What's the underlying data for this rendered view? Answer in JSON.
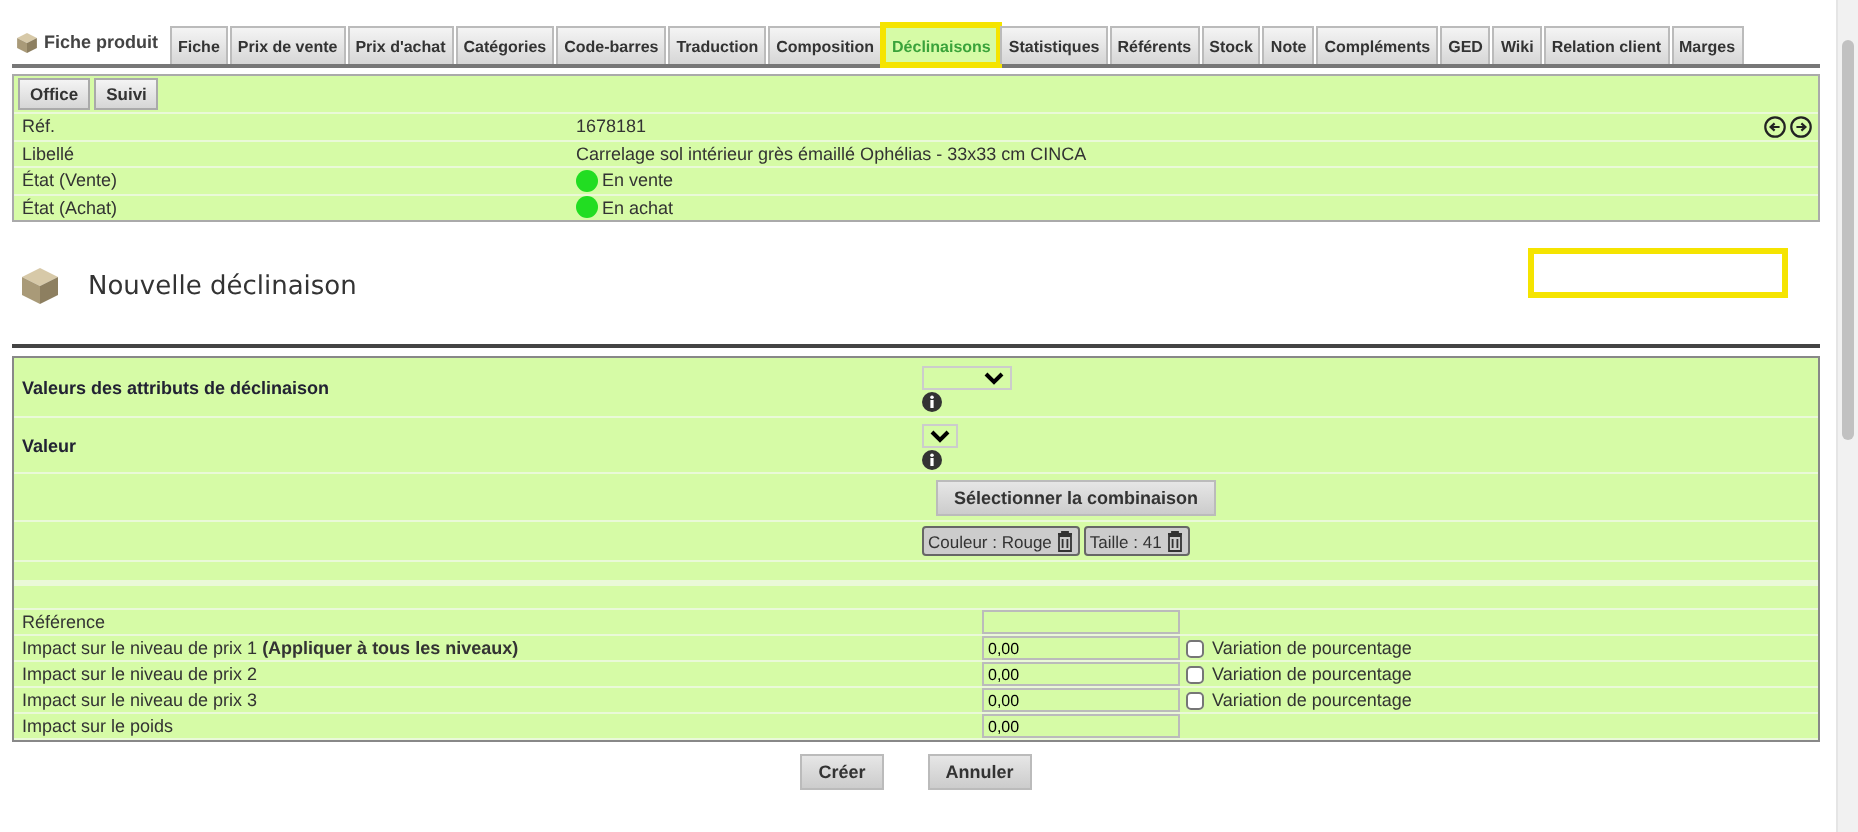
{
  "header": {
    "title": "Fiche produit"
  },
  "tabs": [
    {
      "label": "Fiche",
      "selected": false
    },
    {
      "label": "Prix de vente",
      "selected": false
    },
    {
      "label": "Prix d'achat",
      "selected": false
    },
    {
      "label": "Catégories",
      "selected": false
    },
    {
      "label": "Code-barres",
      "selected": false
    },
    {
      "label": "Traduction",
      "selected": false
    },
    {
      "label": "Composition",
      "selected": false
    },
    {
      "label": "Déclinaisons",
      "selected": true
    },
    {
      "label": "Statistiques",
      "selected": false
    },
    {
      "label": "Référents",
      "selected": false
    },
    {
      "label": "Stock",
      "selected": false
    },
    {
      "label": "Note",
      "selected": false
    },
    {
      "label": "Compléments",
      "selected": false
    },
    {
      "label": "GED",
      "selected": false
    },
    {
      "label": "Wiki",
      "selected": false
    },
    {
      "label": "Relation client",
      "selected": false
    },
    {
      "label": "Marges",
      "selected": false
    }
  ],
  "subtabs": [
    {
      "label": "Office"
    },
    {
      "label": "Suivi"
    }
  ],
  "product": [
    {
      "label": "Réf.",
      "value": "1678181",
      "kind": "text"
    },
    {
      "label": "Libellé",
      "value": "Carrelage sol intérieur grès émaillé Ophélias - 33x33 cm CINCA",
      "kind": "text"
    },
    {
      "label": "État (Vente)",
      "value": "En vente",
      "kind": "status",
      "on": true
    },
    {
      "label": "État (Achat)",
      "value": "En achat",
      "kind": "status",
      "on": true
    }
  ],
  "page_title": "Nouvelle déclinaison",
  "attributes": [
    {
      "label": "Valeurs des attributs de déclinaison",
      "kind": "wide"
    },
    {
      "label": "Valeur",
      "kind": "narrow"
    }
  ],
  "select_button": "Sélectionner la combinaison",
  "chips": [
    "Couleur : Rouge",
    "Taille : 41"
  ],
  "fields": [
    {
      "label": "Référence",
      "kind": "plain"
    },
    {
      "label": "Impact sur le niveau de prix 1 **(Appliquer à tous les niveaux)**",
      "value": "0,00",
      "kind": "percent",
      "checked": false,
      "option": "Variation de pourcentage"
    },
    {
      "label": "Impact sur le niveau de prix 2",
      "value": "0,00",
      "kind": "percent",
      "checked": false,
      "option": "Variation de pourcentage"
    },
    {
      "label": "Impact sur le niveau de prix 3",
      "value": "0,00",
      "kind": "percent",
      "checked": false,
      "option": "Variation de pourcentage"
    },
    {
      "label": "Impact sur le poids",
      "value": "0,00",
      "kind": "plain"
    }
  ],
  "actions": [
    "Créer",
    "Annuler"
  ]
}
